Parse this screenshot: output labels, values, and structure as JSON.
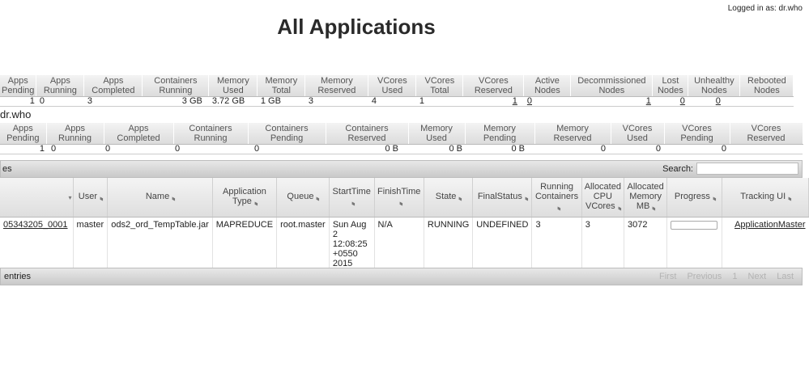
{
  "header": {
    "logged_in": "Logged in as: dr.who",
    "title": "All Applications"
  },
  "cluster_metrics": {
    "headers": [
      "Apps\nPending",
      "Apps\nRunning",
      "Apps\nCompleted",
      "Containers\nRunning",
      "Memory\nUsed",
      "Memory\nTotal",
      "Memory\nReserved",
      "VCores\nUsed",
      "VCores\nTotal",
      "VCores\nReserved",
      "Active\nNodes",
      "Decommissioned\nNodes",
      "Lost\nNodes",
      "Unhealthy\nNodes",
      "Rebooted\nNodes"
    ],
    "values": [
      "1",
      "0",
      "3",
      "3 GB",
      "3.72 GB",
      "1 GB",
      "3",
      "4",
      "1",
      "1",
      "0",
      "1",
      "0",
      "0"
    ]
  },
  "user_metrics": {
    "label": "dr.who",
    "headers": [
      "Apps\nPending",
      "Apps\nRunning",
      "Apps\nCompleted",
      "Containers\nRunning",
      "Containers\nPending",
      "Containers\nReserved",
      "Memory\nUsed",
      "Memory\nPending",
      "Memory\nReserved",
      "VCores\nUsed",
      "VCores\nPending",
      "VCores\nReserved"
    ],
    "values": [
      "1",
      "0",
      "0",
      "0",
      "0",
      "0 B",
      "0 B",
      "0 B",
      "0",
      "0",
      "0"
    ]
  },
  "apps_table": {
    "toolbar_left": "es",
    "search_label": "Search:",
    "search_value": "",
    "columns": [
      "",
      "User",
      "Name",
      "Application\nType",
      "Queue",
      "StartTime",
      "FinishTime",
      "State",
      "FinalStatus",
      "Running\nContainers",
      "Allocated\nCPU\nVCores",
      "Allocated\nMemory\nMB",
      "Progress",
      "Tracking UI"
    ],
    "rows": [
      {
        "id": "05343205_0001",
        "user": "master",
        "name": "ods2_ord_TempTable.jar",
        "type": "MAPREDUCE",
        "queue": "root.master",
        "start_time": "Sun Aug\n2\n12:08:25\n+0550\n2015",
        "finish_time": "N/A",
        "state": "RUNNING",
        "final_status": "UNDEFINED",
        "running_containers": "3",
        "cpu_vcores": "3",
        "memory_mb": "3072",
        "progress": 0.0,
        "tracking_ui": "ApplicationMaster"
      }
    ],
    "info_text": "entries",
    "pager": [
      "First",
      "Previous",
      "1",
      "Next",
      "Last"
    ]
  }
}
